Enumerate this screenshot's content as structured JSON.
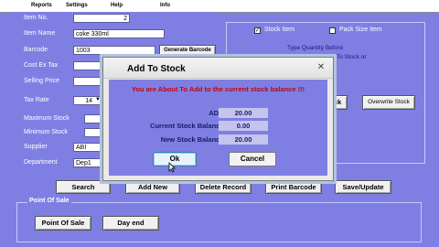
{
  "menu": [
    {
      "label": "Reports"
    },
    {
      "label": "Settings"
    },
    {
      "label": "Help"
    },
    {
      "label": "Info"
    }
  ],
  "form": {
    "item_no": {
      "label": "Item No.",
      "value": "2"
    },
    "item_name": {
      "label": "Item Name",
      "value": "coke 330ml"
    },
    "barcode": {
      "label": "Barcode",
      "value": "1003"
    },
    "generate_barcode_label": "Generate Barcode",
    "cost_ex_tax": {
      "label": "Cost Ex Tax",
      "value": ""
    },
    "selling_price": {
      "label": "Selling Price",
      "value": ""
    },
    "tax_rate": {
      "label": "Tax Rate",
      "value": "14"
    },
    "maximum_stock": {
      "label": "Maximum Stock",
      "value": ""
    },
    "minimum_stock": {
      "label": "Minimum Stock",
      "value": ""
    },
    "supplier": {
      "label": "Supplier",
      "value": "ABI"
    },
    "department": {
      "label": "Department",
      "value": "Dep1"
    }
  },
  "right_panel": {
    "stock_item_label": "Stock Item",
    "stock_item_checked": true,
    "pack_size_item_label": "Pack Size Item",
    "pack_size_item_checked": false,
    "hint_line1": "Type Quantity Before",
    "hint_line2": "To Stock or",
    "add_stock_partial": "ck",
    "overwrite_stock_label": "Overwrite Stock"
  },
  "actions": {
    "search": "Search",
    "add_new": "Add New",
    "delete_record": "Delete Record",
    "print_barcode": "Print Barcode",
    "save_update": "Save/Update"
  },
  "pos": {
    "legend": "Point Of Sale",
    "point_of_sale_button": "Point Of Sale",
    "day_end_button": "Day end"
  },
  "dialog": {
    "title": "Add To Stock",
    "close_glyph": "✕",
    "message": "You are About To Add to the current stock balance !!!",
    "add_label": "ADD:",
    "add_value": "20.00",
    "current_label": "Current Stock Balance:",
    "current_value": "0.00",
    "new_label": "New Stock Balance:",
    "new_value": "20.00",
    "ok_label": "Ok",
    "cancel_label": "Cancel"
  },
  "colors": {
    "background": "#7f7fe3",
    "message_red": "#cc0000",
    "label_navy": "#1a1a6a"
  }
}
